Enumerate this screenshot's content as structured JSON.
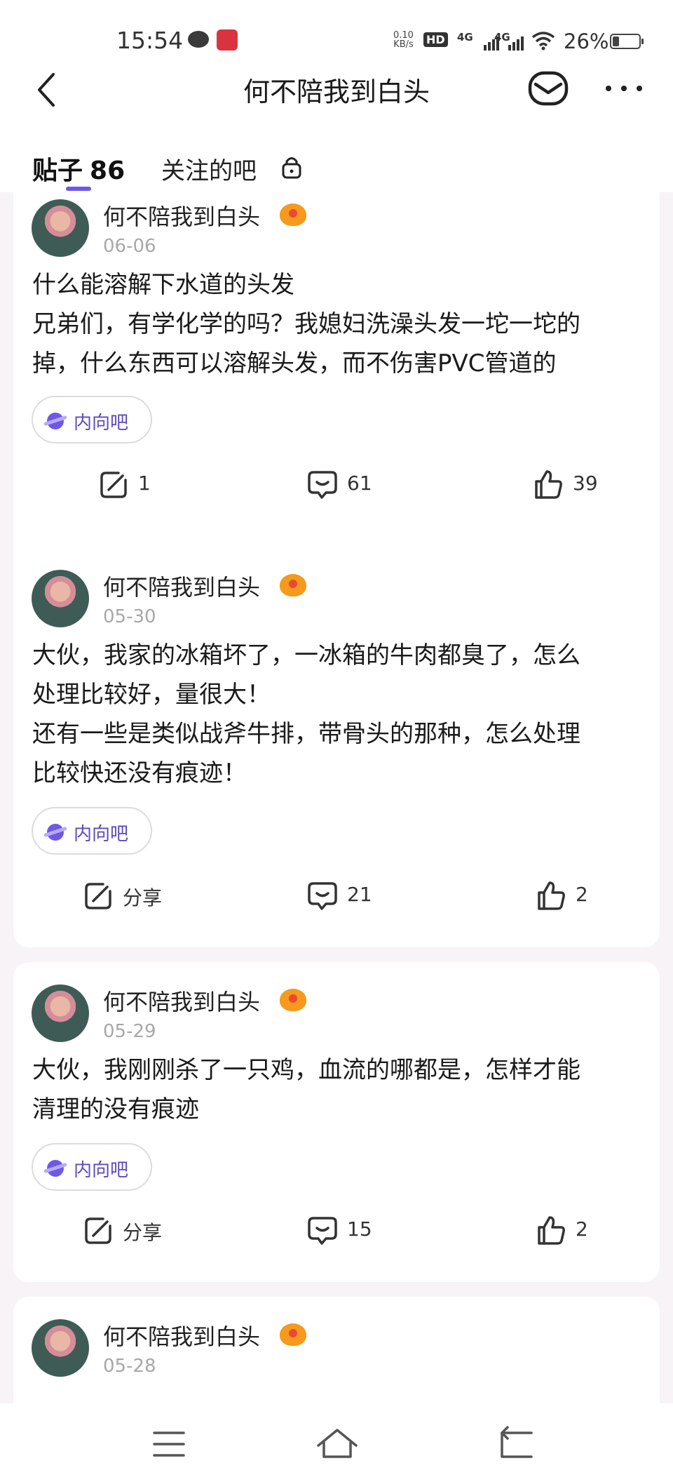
{
  "status_bar": {
    "time": "15:54",
    "network_speed": "0.10",
    "network_unit": "KB/s",
    "hd_label": "HD",
    "signal_1": "4G",
    "signal_2": "4G",
    "battery": "26%",
    "battery_level": 0.26
  },
  "header": {
    "title": "何不陪我到白头"
  },
  "tabs": {
    "posts_label": "贴子",
    "posts_count": "86",
    "followed_label": "关注的吧"
  },
  "posts": [
    {
      "author": "何不陪我到白头",
      "date": "06-06",
      "lines": [
        "什么能溶解下水道的头发",
        "兄弟们，有学化学的吗？我媳妇洗澡头发一坨一坨的",
        "掉，什么东西可以溶解头发，而不伤害PVC管道的"
      ],
      "tag": "内向吧",
      "share": "1",
      "comments": "61",
      "likes": "39"
    },
    {
      "author": "何不陪我到白头",
      "date": "05-30",
      "lines": [
        "大伙，我家的冰箱坏了，一冰箱的牛肉都臭了，怎么",
        "处理比较好，量很大！",
        "还有一些是类似战斧牛排，带骨头的那种，怎么处理",
        "比较快还没有痕迹！"
      ],
      "tag": "内向吧",
      "share": "分享",
      "comments": "21",
      "likes": "2"
    },
    {
      "author": "何不陪我到白头",
      "date": "05-29",
      "lines": [
        "大伙，我刚刚杀了一只鸡，血流的哪都是，怎样才能",
        "清理的没有痕迹"
      ],
      "tag": "内向吧",
      "share": "分享",
      "comments": "15",
      "likes": "2"
    },
    {
      "author": "何不陪我到白头",
      "date": "05-28"
    }
  ],
  "colors": {
    "accent": "#6f57e8",
    "background": "#f7f3f7",
    "date_gray": "#a8a8a8"
  },
  "icons": [
    "back-icon",
    "mail-icon",
    "more-icon",
    "lock-icon",
    "share-icon",
    "comment-icon",
    "like-icon",
    "menu-icon",
    "home-icon",
    "back-nav-icon"
  ]
}
